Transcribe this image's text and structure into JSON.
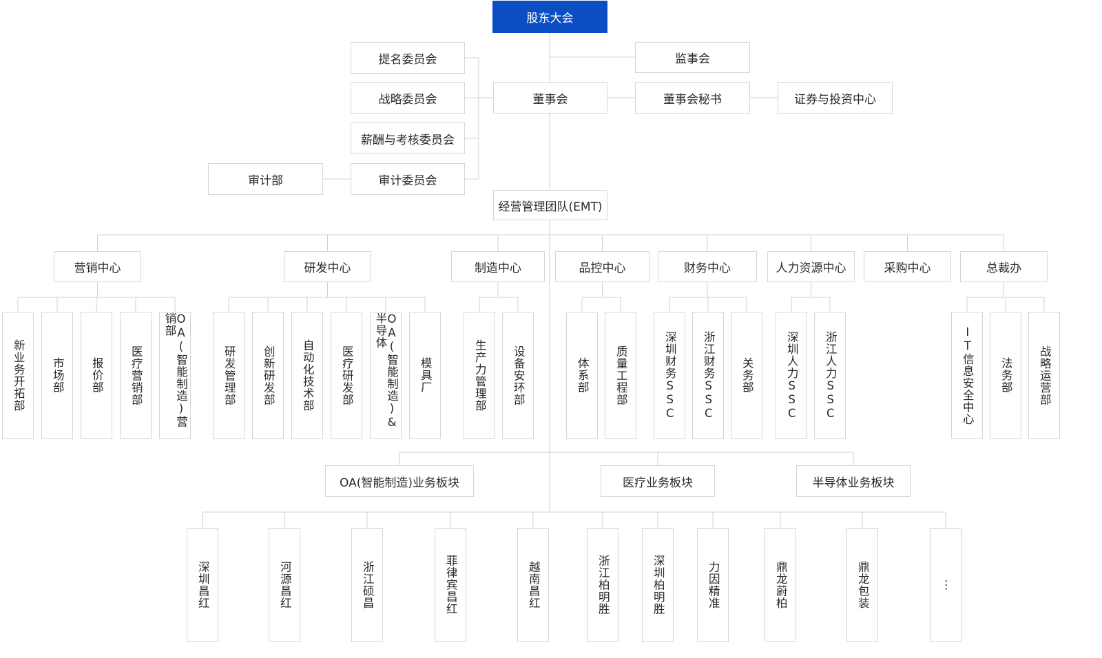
{
  "top": {
    "label": "股东大会"
  },
  "governance": {
    "supervisory": "监事会",
    "board": "董事会",
    "board_secretary": "董事会秘书",
    "securities_center": "证券与投资中心",
    "committees": [
      "提名委员会",
      "战略委员会",
      "薪酬与考核委员会",
      "审计委员会"
    ],
    "audit_dept": "审计部"
  },
  "emt": {
    "label": "经营管理团队(EMT)"
  },
  "centers": [
    {
      "name": "营销中心",
      "depts": [
        "新业务开拓部",
        "市场部",
        "报价部",
        "医疗营销部",
        "OA(智能制造)营销部"
      ]
    },
    {
      "name": "研发中心",
      "depts": [
        "研发管理部",
        "创新研发部",
        "自动化技术部",
        "医疗研发部",
        "OA(智能制造)&半导体",
        "模具厂"
      ]
    },
    {
      "name": "制造中心",
      "depts": [
        "生产力管理部",
        "设备安环部"
      ]
    },
    {
      "name": "品控中心",
      "depts": [
        "体系部",
        "质量工程部"
      ]
    },
    {
      "name": "财务中心",
      "depts": [
        "深圳财务SSC",
        "浙江财务SSC",
        "关务部"
      ]
    },
    {
      "name": "人力资源中心",
      "depts": [
        "深圳人力SSC",
        "浙江人力SSC"
      ]
    },
    {
      "name": "采购中心",
      "depts": []
    },
    {
      "name": "总裁办",
      "depts": [
        "IT信息安全中心",
        "法务部",
        "战略运营部"
      ]
    }
  ],
  "business_units": [
    "OA(智能制造)业务板块",
    "医疗业务板块",
    "半导体业务板块"
  ],
  "subsidiaries": [
    "深圳昌红",
    "河源昌红",
    "浙江硕昌",
    "菲律宾昌红",
    "越南昌红",
    "浙江柏明胜",
    "深圳柏明胜",
    "力因精准",
    "鼎龙蔚柏",
    "鼎龙包装",
    "⋮"
  ],
  "colors": {
    "accent": "#0b4ec4",
    "border": "#d6d6d6",
    "line": "#d0d0d0"
  }
}
